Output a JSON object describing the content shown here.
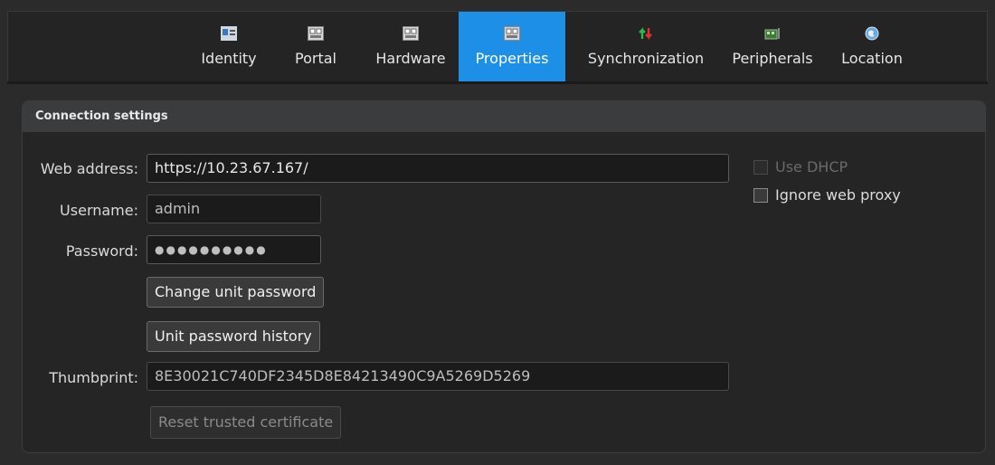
{
  "tabs": [
    {
      "label": "Identity",
      "icon": "identity-icon"
    },
    {
      "label": "Portal",
      "icon": "portal-icon"
    },
    {
      "label": "Hardware",
      "icon": "hardware-icon"
    },
    {
      "label": "Properties",
      "icon": "properties-icon",
      "active": true
    },
    {
      "label": "Synchronization",
      "icon": "sync-icon"
    },
    {
      "label": "Peripherals",
      "icon": "peripherals-icon"
    },
    {
      "label": "Location",
      "icon": "location-icon"
    }
  ],
  "section": {
    "title": "Connection settings"
  },
  "form": {
    "web_address_label": "Web address:",
    "web_address_value": "https://10.23.67.167/",
    "username_label": "Username:",
    "username_value": "admin",
    "password_label": "Password:",
    "password_value": "●●●●●●●●●●",
    "change_password_button": "Change unit password",
    "password_history_button": "Unit password history",
    "thumbprint_label": "Thumbprint:",
    "thumbprint_value": "8E30021C740DF2345D8E84213490C9A5269D5269",
    "reset_cert_button": "Reset trusted certificate"
  },
  "options": {
    "use_dhcp_label": "Use DHCP",
    "use_dhcp_checked": false,
    "use_dhcp_disabled": true,
    "ignore_proxy_label": "Ignore web proxy",
    "ignore_proxy_checked": false
  },
  "colors": {
    "accent": "#1e8fe6",
    "background": "#2b2b2b",
    "panel_header": "#3a3c3e"
  }
}
